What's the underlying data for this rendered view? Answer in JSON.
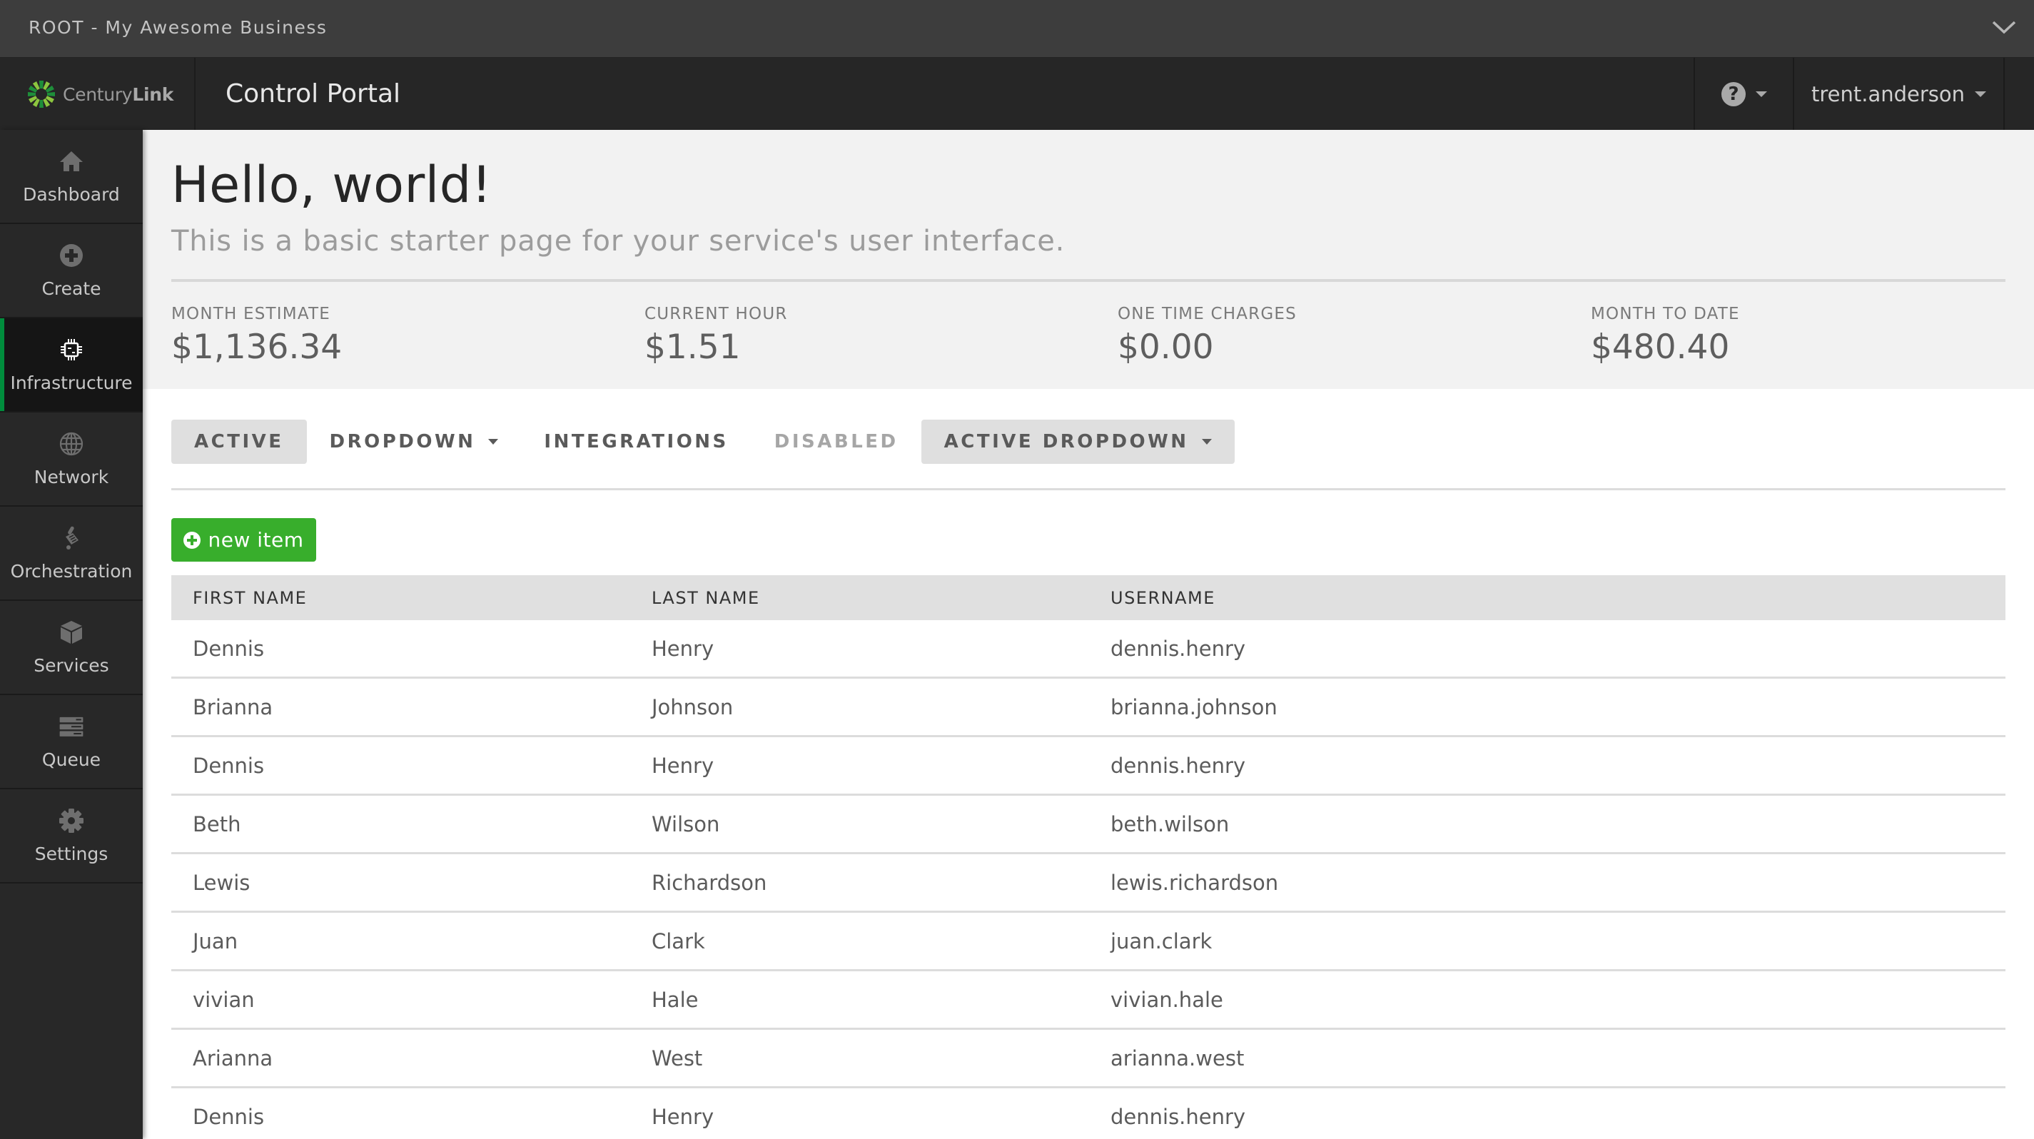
{
  "topbar": {
    "account_name": "ROOT - My Awesome Business",
    "expand_icon": "chevron-down-icon"
  },
  "navbar": {
    "logo_text_regular": "Century",
    "logo_text_bold": "Link",
    "portal_title": "Control Portal",
    "help_icon": "?",
    "username": "trent.anderson"
  },
  "sidebar": {
    "items": [
      {
        "label": "Dashboard",
        "icon": "home-icon",
        "active": false
      },
      {
        "label": "Create",
        "icon": "plus-circle-icon",
        "active": false
      },
      {
        "label": "Infrastructure",
        "icon": "chip-icon",
        "active": true
      },
      {
        "label": "Network",
        "icon": "globe-icon",
        "active": false
      },
      {
        "label": "Orchestration",
        "icon": "orchestration-icon",
        "active": false
      },
      {
        "label": "Services",
        "icon": "cube-icon",
        "active": false
      },
      {
        "label": "Queue",
        "icon": "server-stack-icon",
        "active": false
      },
      {
        "label": "Settings",
        "icon": "gear-icon",
        "active": false
      }
    ]
  },
  "hero": {
    "title": "Hello, world!",
    "subtitle": "This is a basic starter page for your service's user interface.",
    "stats": [
      {
        "label": "MONTH ESTIMATE",
        "value": "$1,136.34"
      },
      {
        "label": "CURRENT HOUR",
        "value": "$1.51"
      },
      {
        "label": "ONE TIME CHARGES",
        "value": "$0.00"
      },
      {
        "label": "MONTH TO DATE",
        "value": "$480.40"
      }
    ]
  },
  "tabs": [
    {
      "label": "ACTIVE",
      "state": "active",
      "dropdown": false
    },
    {
      "label": "DROPDOWN",
      "state": "normal",
      "dropdown": true
    },
    {
      "label": "INTEGRATIONS",
      "state": "normal",
      "dropdown": false
    },
    {
      "label": "DISABLED",
      "state": "disabled",
      "dropdown": false
    },
    {
      "label": "ACTIVE DROPDOWN",
      "state": "active",
      "dropdown": true
    }
  ],
  "actions": {
    "new_item_label": "new item"
  },
  "colors": {
    "brand_green": "#008c3c",
    "button_green": "#38ae2c",
    "topbar_bg": "#3d3d3d",
    "navbar_bg": "#262626"
  },
  "table": {
    "columns": [
      "FIRST NAME",
      "LAST NAME",
      "USERNAME"
    ],
    "rows": [
      [
        "Dennis",
        "Henry",
        "dennis.henry"
      ],
      [
        "Brianna",
        "Johnson",
        "brianna.johnson"
      ],
      [
        "Dennis",
        "Henry",
        "dennis.henry"
      ],
      [
        "Beth",
        "Wilson",
        "beth.wilson"
      ],
      [
        "Lewis",
        "Richardson",
        "lewis.richardson"
      ],
      [
        "Juan",
        "Clark",
        "juan.clark"
      ],
      [
        "vivian",
        "Hale",
        "vivian.hale"
      ],
      [
        "Arianna",
        "West",
        "arianna.west"
      ],
      [
        "Dennis",
        "Henry",
        "dennis.henry"
      ]
    ]
  }
}
